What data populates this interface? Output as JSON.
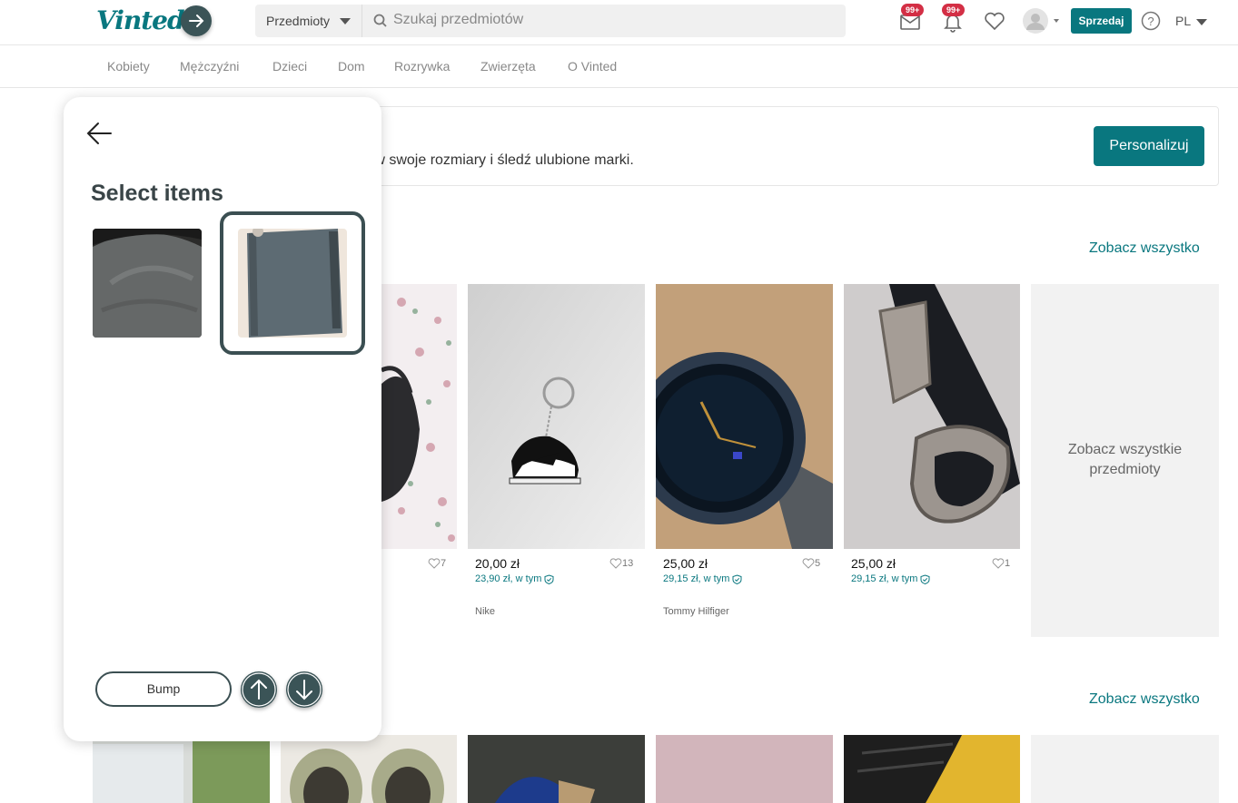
{
  "header": {
    "logo": "Vinted",
    "category_select": "Przedmioty",
    "search_placeholder": "Szukaj przedmiotów",
    "messages_badge": "99+",
    "notifications_badge": "99+",
    "sell_button": "Sprzedaj",
    "language": "PL",
    "brand_color": "#09777f"
  },
  "nav": [
    "Kobiety",
    "Mężczyźni",
    "Dzieci",
    "Dom",
    "Rozrywka",
    "Zwierzęta",
    "O Vinted"
  ],
  "banner": {
    "text": "taw swoje rozmiary i śledź ulubione marki.",
    "button": "Personalizuj"
  },
  "sections": [
    {
      "see_all": "Zobacz wszystko"
    },
    {
      "see_all": "Zobacz wszystko"
    }
  ],
  "items": [
    {
      "price": "",
      "price_protection": "",
      "likes": "7",
      "brand": ""
    },
    {
      "price": "20,00 zł",
      "price_protection": "23,90 zł, w tym",
      "likes": "13",
      "brand": "Nike"
    },
    {
      "price": "25,00 zł",
      "price_protection": "29,15 zł, w tym",
      "likes": "5",
      "brand": "Tommy Hilfiger"
    },
    {
      "price": "25,00 zł",
      "price_protection": "29,15 zł, w tym",
      "likes": "1",
      "brand": ""
    }
  ],
  "see_all_items": "Zobacz wszystkie przedmioty",
  "panel": {
    "title": "Select items",
    "bump_button": "Bump",
    "selected_index": 1,
    "accent_color": "#3b4f52"
  }
}
